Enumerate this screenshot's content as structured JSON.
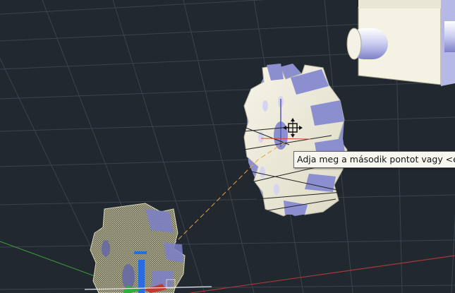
{
  "viewport": {
    "background": "#212830",
    "grid_color": "#3a4350",
    "axis_x_color": "#a33a3a",
    "axis_y_color": "#3b8a3b",
    "tracking_line_color": "#e8a53a"
  },
  "tooltip": {
    "text": "Adja meg a második pontot vagy <első po"
  },
  "icons": {
    "cursor": "move-pickbox-cursor-icon",
    "ucs": "ucs-axis-icon"
  },
  "colors": {
    "solid_face": "#f2f0e2",
    "shade_face": "#8b8fd0",
    "wireframe": "#c9c7a6"
  }
}
